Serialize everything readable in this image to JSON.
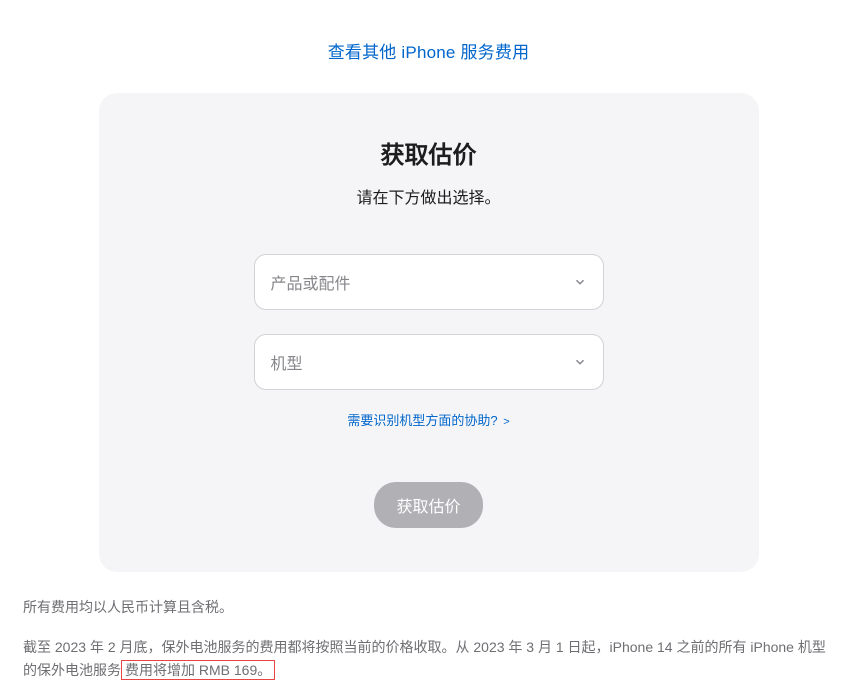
{
  "topLink": {
    "label": "查看其他 iPhone 服务费用"
  },
  "card": {
    "title": "获取估价",
    "subtitle": "请在下方做出选择。",
    "selectProduct": "产品或配件",
    "selectModel": "机型",
    "helpLink": "需要识别机型方面的协助?",
    "helpArrow": ">",
    "submitLabel": "获取估价"
  },
  "footer": {
    "note1": "所有费用均以人民币计算且含税。",
    "note2_part1": "截至 2023 年 2 月底，保外电池服务的费用都将按照当前的价格收取。从 2023 年 3 月 1 日起，iPhone 14 之前的所有 iPhone 机型的保外电池服务",
    "note2_highlight": "费用将增加 RMB 169。"
  }
}
